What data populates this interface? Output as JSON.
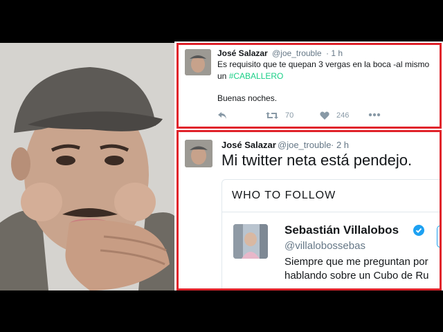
{
  "tweet1": {
    "name": "José Salazar",
    "handle": "@joe_trouble",
    "time": "· 1 h",
    "line1": "Es requisito que te quepan 3 vergas en la boca -al mismo",
    "line2_prefix": "un ",
    "hashtag": "#CABALLERO",
    "line3": "Buenas noches.",
    "retweets": "70",
    "likes": "246"
  },
  "tweet2": {
    "name": "José Salazar",
    "handle": "@joe_trouble",
    "time": "· 2 h",
    "text": "Mi twitter neta está pendejo.",
    "who_to_follow": {
      "title": "WHO TO FOLLOW",
      "user_name": "Sebastián Villalobos",
      "user_handle": "@villalobossebas",
      "bio_line1": "Siempre que me preguntan por",
      "bio_line2": "hablando sobre un Cubo de Ru"
    }
  },
  "colors": {
    "border_red": "#e0232b",
    "hashtag_green": "#19cf86",
    "verified_blue": "#1da1f2",
    "muted": "#657786"
  },
  "icons": [
    "reply-icon",
    "retweet-icon",
    "like-icon",
    "more-icon",
    "verified-icon"
  ]
}
